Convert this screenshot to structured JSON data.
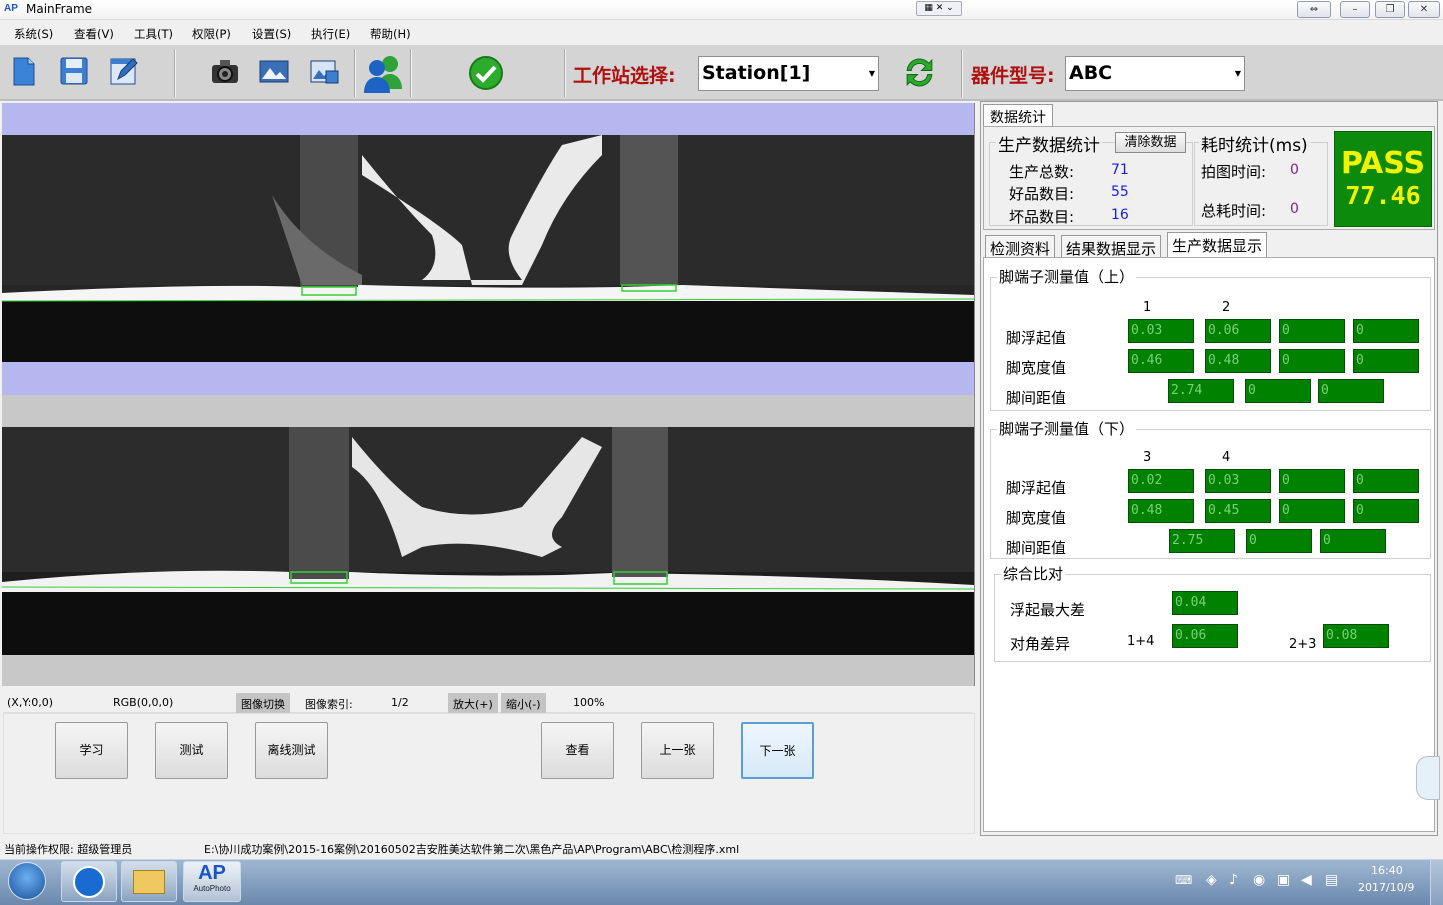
{
  "window": {
    "title": "MainFrame",
    "app_icon": "AP"
  },
  "menu": [
    "系统(S)",
    "查看(V)",
    "工具(T)",
    "权限(P)",
    "设置(S)",
    "执行(E)",
    "帮助(H)"
  ],
  "toolbar": {
    "icons": [
      "new-document-icon",
      "save-icon",
      "edit-icon",
      "camera-icon",
      "image-icon",
      "image-save-icon",
      "users-icon",
      "check-icon",
      "refresh-icon"
    ],
    "station_label": "工作站选择:",
    "station_value": "Station[1]",
    "part_label": "器件型号:",
    "part_value": "ABC"
  },
  "infobar": {
    "xy": "(X,Y:0,0)",
    "rgb": "RGB(0,0,0)",
    "switch": "图像切换",
    "index_label": "图像索引:",
    "index_value": "1/2",
    "zoom_in": "放大(+)",
    "zoom_out": "缩小(-)",
    "zoom": "100%"
  },
  "buttons": {
    "learn": "学习",
    "test": "测试",
    "offline": "离线测试",
    "view": "查看",
    "prev": "上一张",
    "next": "下一张"
  },
  "status": {
    "permission": "当前操作权限:  超级管理员",
    "path": "E:\\协川成功案例\\2015-16案例\\20160502吉安胜美达软件第二次\\黑色产品\\AP\\Program\\ABC\\检测程序.xml"
  },
  "stats": {
    "tab": "数据统计",
    "production_title": "生产数据统计",
    "clear_button": "清除数据",
    "total_label": "生产总数:",
    "total": "71",
    "good_label": "好品数目:",
    "good": "55",
    "bad_label": "坏品数目:",
    "bad": "16",
    "time_title": "耗时统计(ms)",
    "capture_label": "拍图时间:",
    "capture": "0",
    "total_time_label": "总耗时间:",
    "total_time": "0",
    "result": "PASS",
    "result_value": "77.46"
  },
  "subtabs": [
    "检测资料",
    "结果数据显示",
    "生产数据显示"
  ],
  "upper": {
    "title": "脚端子测量值（上）",
    "col1": "1",
    "col2": "2",
    "float_label": "脚浮起值",
    "float": [
      "0.03",
      "0.06",
      "0",
      "0"
    ],
    "width_label": "脚宽度值",
    "width": [
      "0.46",
      "0.48",
      "0",
      "0"
    ],
    "pitch_label": "脚间距值",
    "pitch": [
      "2.74",
      "0",
      "0"
    ]
  },
  "lower": {
    "title": "脚端子测量值（下）",
    "col1": "3",
    "col2": "4",
    "float_label": "脚浮起值",
    "float": [
      "0.02",
      "0.03",
      "0",
      "0"
    ],
    "width_label": "脚宽度值",
    "width": [
      "0.48",
      "0.45",
      "0",
      "0"
    ],
    "pitch_label": "脚间距值",
    "pitch": [
      "2.75",
      "0",
      "0"
    ]
  },
  "compare": {
    "title": "综合比对",
    "max_float_label": "浮起最大差",
    "max_float": "0.04",
    "diag_label": "对角差异",
    "diag_a_label": "1+4",
    "diag_a": "0.06",
    "diag_b_label": "2+3",
    "diag_b": "0.08"
  },
  "taskbar": {
    "time": "16:40",
    "date": "2017/10/9",
    "app_label": "AP",
    "app_sub": "AutoPhoto"
  },
  "colors": {
    "pass_bg": "#0b8a0b",
    "pass_text": "#f3f300",
    "field_green": "#008200",
    "label_red": "#b01010"
  }
}
